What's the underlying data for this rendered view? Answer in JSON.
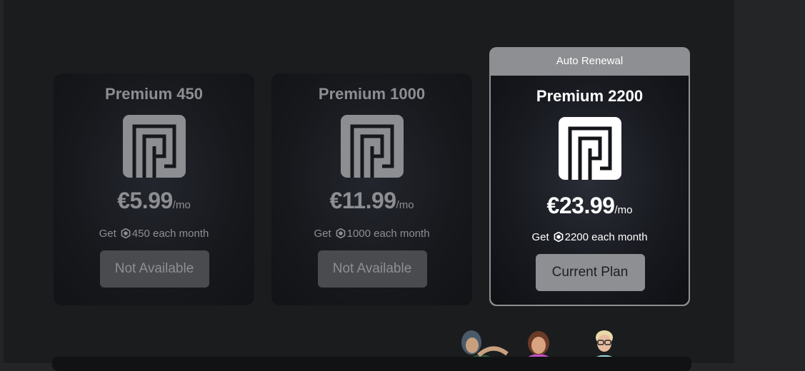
{
  "plans": [
    {
      "title": "Premium 450",
      "price": "€5.99",
      "per": "/mo",
      "get_prefix": "Get",
      "robux_text": "450 each month",
      "button_label": "Not Available"
    },
    {
      "title": "Premium 1000",
      "price": "€11.99",
      "per": "/mo",
      "get_prefix": "Get",
      "robux_text": "1000 each month",
      "button_label": "Not Available"
    },
    {
      "title": "Premium 2200",
      "price": "€23.99",
      "per": "/mo",
      "get_prefix": "Get",
      "robux_text": "2200 each month",
      "button_label": "Current Plan",
      "banner": "Auto Renewal"
    }
  ],
  "icons": {
    "plan_logo": "premium-logo-icon",
    "currency": "robux-icon"
  },
  "colors": {
    "page_bg": "#1b1c1e",
    "card_bg": "#17181c",
    "featured_border": "#8d8f92",
    "muted_text": "#8d8e92",
    "active_text": "#ffffff",
    "disabled_button": "#4a4b4f",
    "current_button": "#8d8f92"
  }
}
